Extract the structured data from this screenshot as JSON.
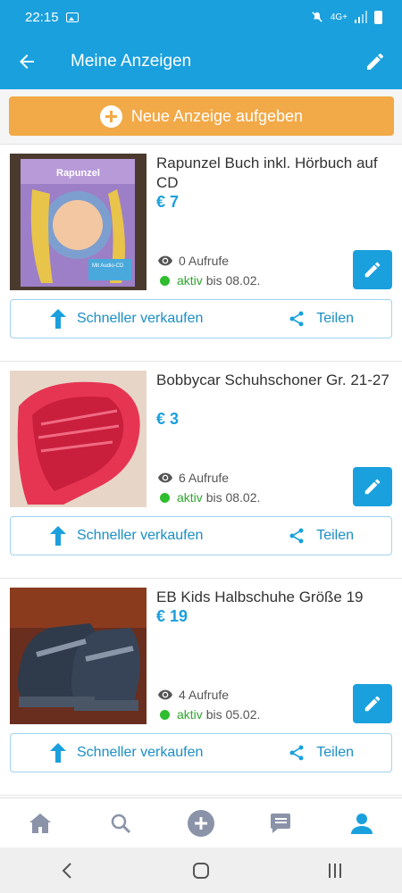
{
  "status_bar": {
    "time": "22:15",
    "network": "4G+"
  },
  "app_bar": {
    "title": "Meine Anzeigen"
  },
  "new_ad": {
    "label": "Neue Anzeige aufgeben"
  },
  "listings": [
    {
      "title": "Rapunzel Buch inkl. Hörbuch auf CD",
      "price": "€ 7",
      "views": "0 Aufrufe",
      "status": "aktiv",
      "until": "bis 08.02.",
      "sell_label": "Schneller verkaufen",
      "share_label": "Teilen",
      "thumb_text": "Rapunzel",
      "thumb_subtext": "Mit Audio-CD"
    },
    {
      "title": "Bobbycar Schuhschoner Gr. 21-27",
      "price": "€ 3",
      "views": "6 Aufrufe",
      "status": "aktiv",
      "until": "bis 08.02.",
      "sell_label": "Schneller verkaufen",
      "share_label": "Teilen"
    },
    {
      "title": "EB Kids Halbschuhe Größe 19",
      "price": "€ 19",
      "views": "4 Aufrufe",
      "status": "aktiv",
      "until": "bis 05.02.",
      "sell_label": "Schneller verkaufen",
      "share_label": "Teilen"
    }
  ],
  "colors": {
    "primary": "#1aa0dd",
    "accent": "#f2a947",
    "active": "#2ebd2e"
  },
  "bottom_nav": [
    "home-icon",
    "search-icon",
    "add-icon",
    "messages-icon",
    "profile-icon"
  ]
}
